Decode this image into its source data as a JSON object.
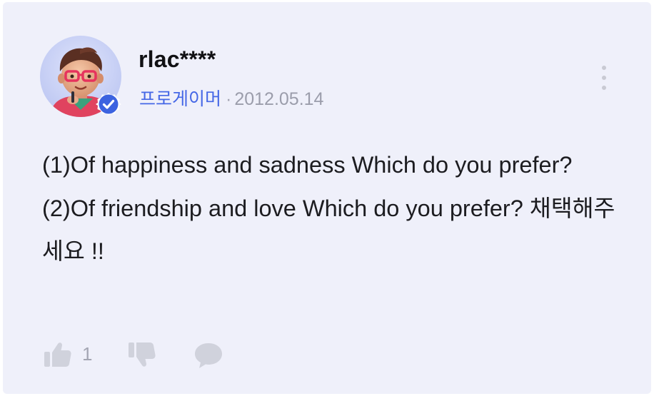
{
  "post": {
    "author": {
      "username": "rlac****",
      "level": "프로게이머",
      "separator": "·",
      "date": "2012.05.14",
      "avatar_icon": "glasses-character-avatar",
      "verified_icon": "verified-check-badge-icon"
    },
    "content": {
      "line1": "(1)Of happiness and sadness Which do you prefer?",
      "line2": "(2)Of friendship and love Which do you prefer? 채택해주세요 !!"
    },
    "actions": {
      "like_count": "1",
      "like_icon": "thumbs-up-icon",
      "dislike_icon": "thumbs-down-icon",
      "comment_icon": "comment-bubble-icon",
      "more_icon": "more-vertical-icon"
    }
  },
  "colors": {
    "card_background": "#eff0fa",
    "level_accent": "#4567e6",
    "muted_text": "#9b9dab",
    "icon_gray": "#d0d2dc",
    "badge_blue": "#3c63e0"
  }
}
